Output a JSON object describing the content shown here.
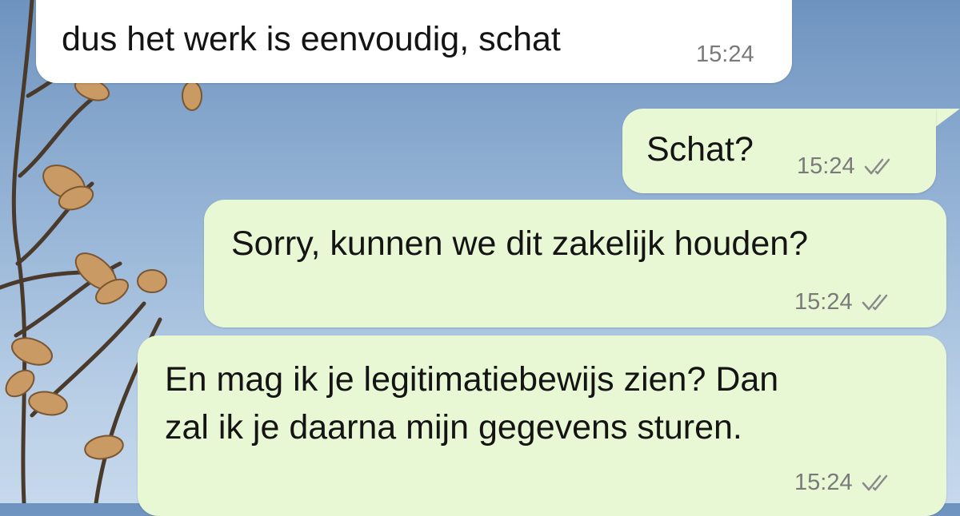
{
  "messages": [
    {
      "direction": "incoming",
      "text": "dus het werk is eenvoudig, schat",
      "time": "15:24"
    },
    {
      "direction": "outgoing",
      "text": "Schat?",
      "time": "15:24",
      "status": "read-double-check-icon"
    },
    {
      "direction": "outgoing",
      "text": "Sorry, kunnen we dit zakelijk houden?",
      "time": "15:24",
      "status": "read-double-check-icon"
    },
    {
      "direction": "outgoing",
      "lines": [
        "En mag ik je legitimatiebewijs zien? Dan",
        "zal ik je daarna mijn gegevens sturen."
      ],
      "time": "15:24",
      "status": "read-double-check-icon"
    }
  ],
  "colors": {
    "incoming_bubble": "#ffffff",
    "outgoing_bubble": "#e8f8d5",
    "timestamp": "#7a7a7a",
    "sky": "#86a7cd"
  }
}
